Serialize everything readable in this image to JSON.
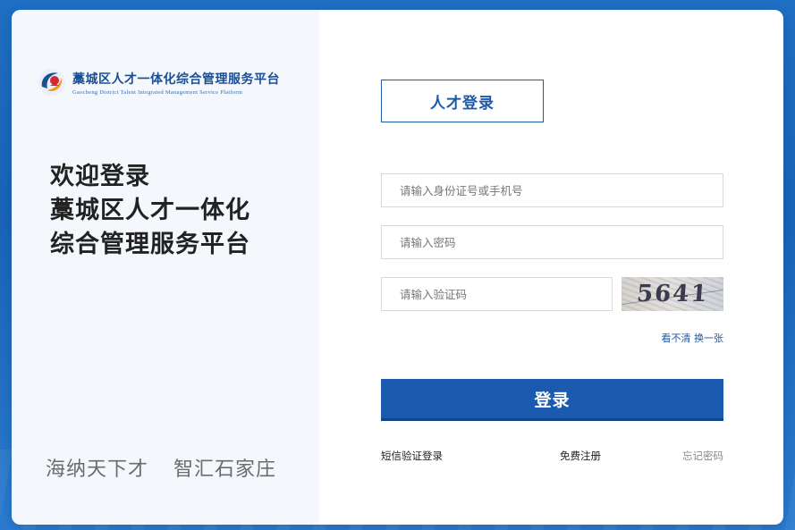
{
  "brand": {
    "name_cn": "藁城区人才一体化综合管理服务平台",
    "name_en": "Gaocheng District Talent Integrated Management Service Platform",
    "colors": {
      "primary": "#1a5bb0",
      "logo_blue": "#1b4f95",
      "logo_orange": "#f39a1e",
      "logo_red": "#d7262f"
    }
  },
  "welcome": {
    "line1": "欢迎登录",
    "line2": "藁城区人才一体化",
    "line3": "综合管理服务平台"
  },
  "slogan": {
    "part1": "海纳天下才",
    "part2": "智汇石家庄"
  },
  "login": {
    "tab_label": "人才登录",
    "id_placeholder": "请输入身份证号或手机号",
    "password_placeholder": "请输入密码",
    "captcha_placeholder": "请输入验证码",
    "captcha_text": "5641",
    "refresh_label": "看不清 换一张",
    "submit_label": "登录"
  },
  "links": {
    "sms_login": "短信验证登录",
    "register": "免费注册",
    "forgot": "忘记密码"
  }
}
